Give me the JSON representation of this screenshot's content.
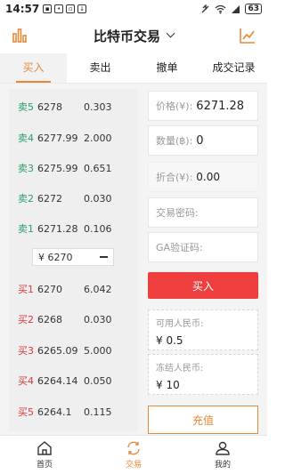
{
  "status_bar": {
    "time": "14:57",
    "battery": "63"
  },
  "header": {
    "title": "比特币交易"
  },
  "tabs": [
    {
      "label": "买入",
      "active": true
    },
    {
      "label": "卖出",
      "active": false
    },
    {
      "label": "撤单",
      "active": false
    },
    {
      "label": "成交记录",
      "active": false
    }
  ],
  "order_book": {
    "sells": [
      {
        "label": "卖5",
        "price": "6278",
        "qty": "0.303"
      },
      {
        "label": "卖4",
        "price": "6277.99",
        "qty": "2.000"
      },
      {
        "label": "卖3",
        "price": "6275.99",
        "qty": "0.651"
      },
      {
        "label": "卖2",
        "price": "6272",
        "qty": "0.030"
      },
      {
        "label": "卖1",
        "price": "6271.28",
        "qty": "0.106"
      }
    ],
    "last_price": "¥ 6270",
    "buys": [
      {
        "label": "买1",
        "price": "6270",
        "qty": "6.042"
      },
      {
        "label": "买2",
        "price": "6268",
        "qty": "0.030"
      },
      {
        "label": "买3",
        "price": "6265.09",
        "qty": "5.000"
      },
      {
        "label": "买4",
        "price": "6264.14",
        "qty": "0.050"
      },
      {
        "label": "买5",
        "price": "6264.1",
        "qty": "0.115"
      }
    ]
  },
  "form": {
    "price_label": "价格(¥):",
    "price_value": "6271.28",
    "qty_label": "数量(฿):",
    "qty_value": "0",
    "total_label": "折合(¥):",
    "total_value": "0.00",
    "password_placeholder": "交易密码:",
    "ga_placeholder": "GA验证码:",
    "buy_button": "买入",
    "available_label": "可用人民币:",
    "available_value": "¥ 0.5",
    "frozen_label": "冻结人民币:",
    "frozen_value": "¥ 10",
    "recharge_button": "充值"
  },
  "bottom_nav": [
    {
      "label": "首页",
      "icon": "home-icon",
      "active": false
    },
    {
      "label": "交易",
      "icon": "exchange-icon",
      "active": true
    },
    {
      "label": "我的",
      "icon": "user-icon",
      "active": false
    }
  ],
  "colors": {
    "accent": "#e8883a",
    "sell": "#2b9f6b",
    "buy": "#d9383a",
    "buy_button": "#ee3e3e"
  }
}
